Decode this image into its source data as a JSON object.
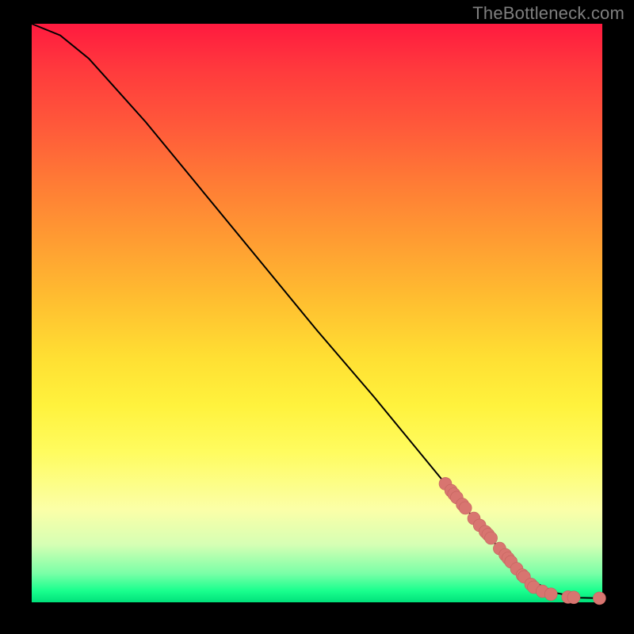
{
  "watermark": "TheBottleneck.com",
  "chart_data": {
    "type": "line",
    "title": "",
    "xlabel": "",
    "ylabel": "",
    "xlim": [
      0,
      100
    ],
    "ylim": [
      0,
      100
    ],
    "curve": {
      "x": [
        0,
        5,
        10,
        20,
        30,
        40,
        50,
        60,
        70,
        75,
        80,
        84,
        88,
        92,
        96,
        100
      ],
      "y": [
        100,
        98,
        94,
        83,
        71,
        59,
        47,
        35.5,
        23.5,
        17.5,
        11.5,
        7,
        3.5,
        1.6,
        0.8,
        0.7
      ]
    },
    "series": [
      {
        "name": "points",
        "type": "scatter",
        "x": [
          72.5,
          73.5,
          74.0,
          74.5,
          75.5,
          76.0,
          77.5,
          78.5,
          79.5,
          80.0,
          80.5,
          82.0,
          83.0,
          83.5,
          84.0,
          85.0,
          86.0,
          86.3,
          87.5,
          88.0,
          89.5,
          91.0,
          94.0,
          95.0,
          99.5
        ],
        "y": [
          20.5,
          19.3,
          18.7,
          18.1,
          16.9,
          16.3,
          14.5,
          13.3,
          12.2,
          11.7,
          11.1,
          9.3,
          8.2,
          7.6,
          7.0,
          5.8,
          4.7,
          4.4,
          3.1,
          2.6,
          1.9,
          1.4,
          0.9,
          0.85,
          0.7
        ]
      }
    ],
    "background_gradient": {
      "orientation": "vertical",
      "stops": [
        {
          "pos": 0.0,
          "color": "#ff1a3f"
        },
        {
          "pos": 0.08,
          "color": "#ff3a3d"
        },
        {
          "pos": 0.18,
          "color": "#ff5a3a"
        },
        {
          "pos": 0.28,
          "color": "#ff7d35"
        },
        {
          "pos": 0.38,
          "color": "#ff9e32"
        },
        {
          "pos": 0.48,
          "color": "#ffbf30"
        },
        {
          "pos": 0.58,
          "color": "#ffe033"
        },
        {
          "pos": 0.66,
          "color": "#fff23d"
        },
        {
          "pos": 0.74,
          "color": "#fffc5f"
        },
        {
          "pos": 0.84,
          "color": "#fbffa8"
        },
        {
          "pos": 0.9,
          "color": "#d6ffb4"
        },
        {
          "pos": 0.95,
          "color": "#7affa7"
        },
        {
          "pos": 0.98,
          "color": "#1aff8e"
        },
        {
          "pos": 1.0,
          "color": "#00e17a"
        }
      ]
    },
    "point_color": "#d87570",
    "point_radius": 8
  }
}
